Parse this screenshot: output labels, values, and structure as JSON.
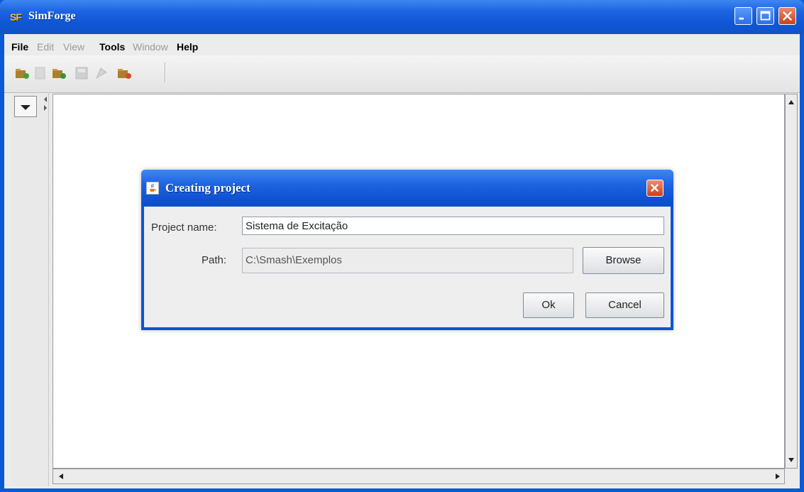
{
  "window": {
    "logo_text": "SF",
    "title": "SimForge"
  },
  "menu": {
    "file": "File",
    "edit": "Edit",
    "view": "View",
    "tools": "Tools",
    "window": "Window",
    "help": "Help"
  },
  "toolbar": {
    "icons": [
      "new-project-icon",
      "new-file-icon",
      "open-project-icon",
      "save-icon",
      "export-icon",
      "close-project-icon"
    ]
  },
  "dialog": {
    "title": "Creating project",
    "project_name_label": "Project name:",
    "project_name_value": "Sistema de Excitação",
    "path_label": "Path:",
    "path_value": "C:\\Smash\\Exemplos",
    "browse_label": "Browse",
    "ok_label": "Ok",
    "cancel_label": "Cancel"
  },
  "colors": {
    "titlebar": "#0f55d5",
    "accent": "#f2b84b",
    "close": "#c9421c"
  }
}
